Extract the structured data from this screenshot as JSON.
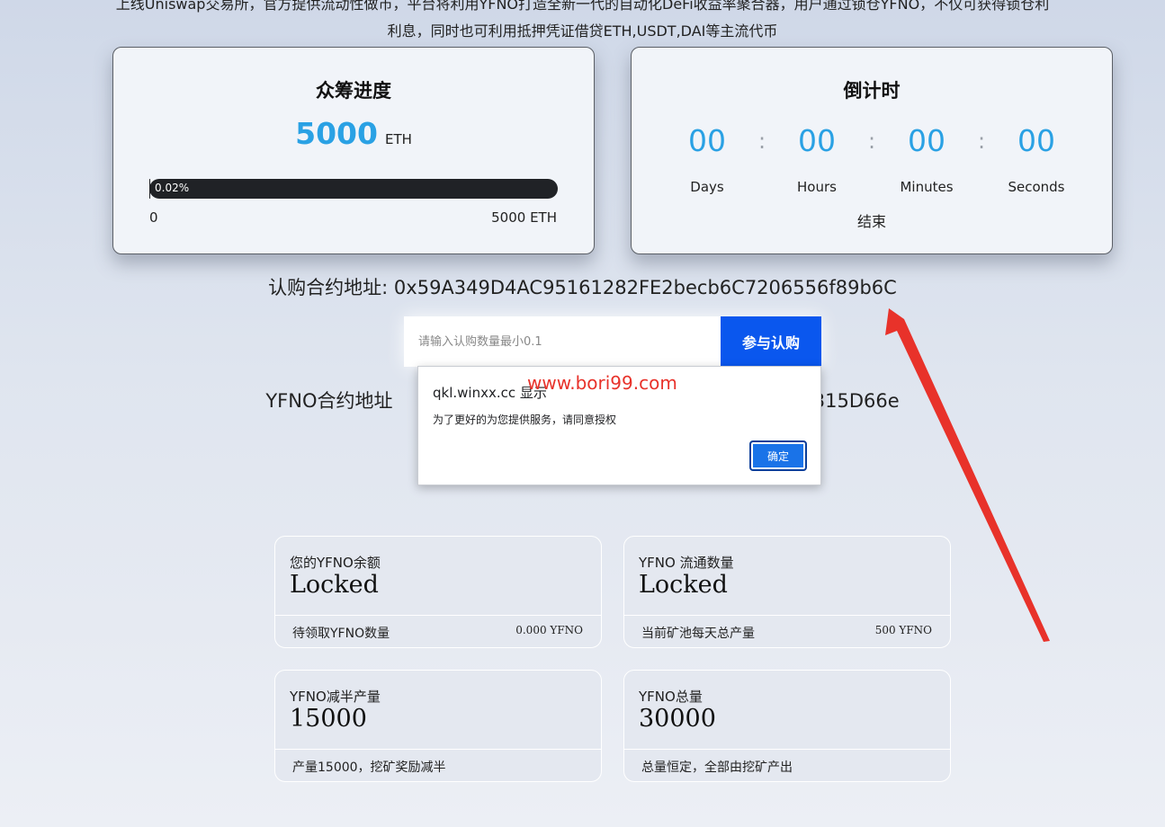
{
  "intro": {
    "line1": "上线Uniswap交易所，官方提供流动性做市，平台将利用YFNO打造全新一代的自动化DeFi收益率聚合器，用户通过锁仓YFNO，不仅可获得锁仓利",
    "line2": "利息，同时也可利用抵押凭证借贷ETH,USDT,DAI等主流代币"
  },
  "crowdfunding": {
    "title": "众筹进度",
    "raised_value": "5000",
    "raised_unit": "ETH",
    "progress_percent": 0.02,
    "progress_label": "0.02%",
    "min_label": "0",
    "max_label": "5000 ETH"
  },
  "countdown": {
    "title": "倒计时",
    "days": "00",
    "hours": "00",
    "minutes": "00",
    "seconds": "00",
    "separator": ":",
    "days_label": "Days",
    "hours_label": "Hours",
    "minutes_label": "Minutes",
    "seconds_label": "Seconds",
    "status": "结束"
  },
  "subscription": {
    "address_text": "认购合约地址: 0x59A349D4AC95161282FE2becb6C7206556f89b6C",
    "input_placeholder": "请输入认购数量最小0.1",
    "button_label": "参与认购"
  },
  "token_address": {
    "left_text": "YFNO合约地址",
    "right_text": "Aa315D66e"
  },
  "dialog": {
    "title": "qkl.winxx.cc 显示",
    "message": "为了更好的为您提供服务，请同意授权",
    "ok_label": "确定"
  },
  "watermark": "www.bori99.com",
  "stats": [
    {
      "label": "您的YFNO余额",
      "value": "Locked",
      "foot_left": "待领取YFNO数量",
      "foot_right": "0.000 YFNO"
    },
    {
      "label": "YFNO 流通数量",
      "value": "Locked",
      "foot_left": "当前矿池每天总产量",
      "foot_right": "500 YFNO"
    },
    {
      "label": "YFNO减半产量",
      "value": "15000",
      "foot_left": "产量15000，挖矿奖励减半",
      "foot_right": ""
    },
    {
      "label": "YFNO总量",
      "value": "30000",
      "foot_left": "总量恒定，全部由挖矿产出",
      "foot_right": ""
    }
  ],
  "colors": {
    "accent_blue": "#2aa1e4",
    "button_blue": "#0a57ee",
    "arrow_red": "#e8322a"
  }
}
